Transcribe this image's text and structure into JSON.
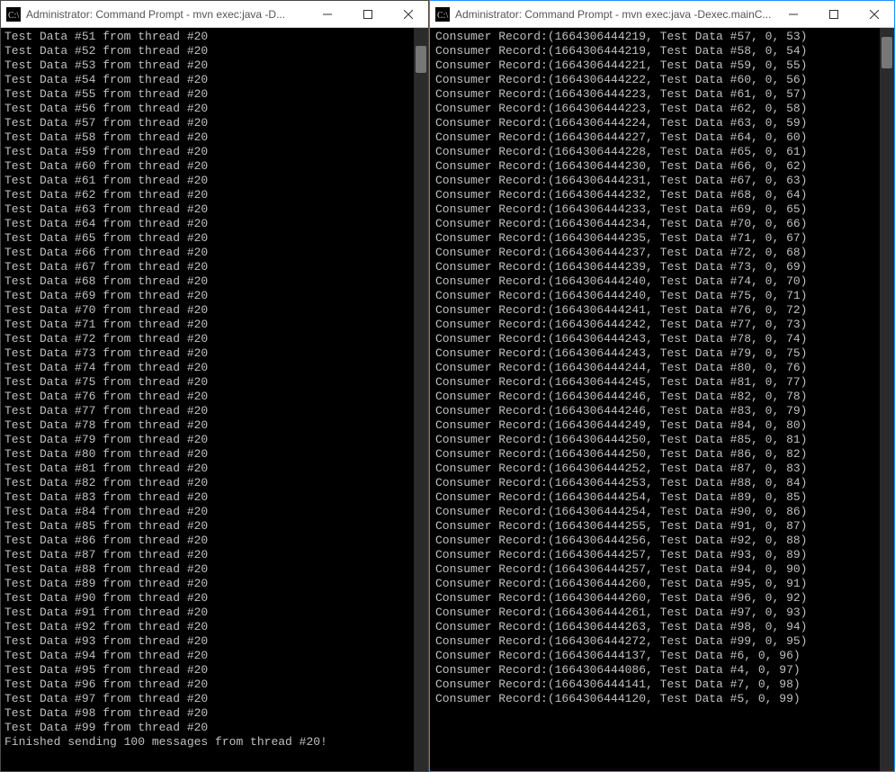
{
  "left_window": {
    "title": "Administrator: Command Prompt - mvn  exec:java -D...",
    "lines": [
      "Test Data #51 from thread #20",
      "Test Data #52 from thread #20",
      "Test Data #53 from thread #20",
      "Test Data #54 from thread #20",
      "Test Data #55 from thread #20",
      "Test Data #56 from thread #20",
      "Test Data #57 from thread #20",
      "Test Data #58 from thread #20",
      "Test Data #59 from thread #20",
      "Test Data #60 from thread #20",
      "Test Data #61 from thread #20",
      "Test Data #62 from thread #20",
      "Test Data #63 from thread #20",
      "Test Data #64 from thread #20",
      "Test Data #65 from thread #20",
      "Test Data #66 from thread #20",
      "Test Data #67 from thread #20",
      "Test Data #68 from thread #20",
      "Test Data #69 from thread #20",
      "Test Data #70 from thread #20",
      "Test Data #71 from thread #20",
      "Test Data #72 from thread #20",
      "Test Data #73 from thread #20",
      "Test Data #74 from thread #20",
      "Test Data #75 from thread #20",
      "Test Data #76 from thread #20",
      "Test Data #77 from thread #20",
      "Test Data #78 from thread #20",
      "Test Data #79 from thread #20",
      "Test Data #80 from thread #20",
      "Test Data #81 from thread #20",
      "Test Data #82 from thread #20",
      "Test Data #83 from thread #20",
      "Test Data #84 from thread #20",
      "Test Data #85 from thread #20",
      "Test Data #86 from thread #20",
      "Test Data #87 from thread #20",
      "Test Data #88 from thread #20",
      "Test Data #89 from thread #20",
      "Test Data #90 from thread #20",
      "Test Data #91 from thread #20",
      "Test Data #92 from thread #20",
      "Test Data #93 from thread #20",
      "Test Data #94 from thread #20",
      "Test Data #95 from thread #20",
      "Test Data #96 from thread #20",
      "Test Data #97 from thread #20",
      "Test Data #98 from thread #20",
      "Test Data #99 from thread #20",
      "Finished sending 100 messages from thread #20!"
    ]
  },
  "right_window": {
    "title": "Administrator: Command Prompt - mvn  exec:java -Dexec.mainC...",
    "lines": [
      "Consumer Record:(1664306444219, Test Data #57, 0, 53)",
      "Consumer Record:(1664306444219, Test Data #58, 0, 54)",
      "Consumer Record:(1664306444221, Test Data #59, 0, 55)",
      "Consumer Record:(1664306444222, Test Data #60, 0, 56)",
      "Consumer Record:(1664306444223, Test Data #61, 0, 57)",
      "Consumer Record:(1664306444223, Test Data #62, 0, 58)",
      "Consumer Record:(1664306444224, Test Data #63, 0, 59)",
      "Consumer Record:(1664306444227, Test Data #64, 0, 60)",
      "Consumer Record:(1664306444228, Test Data #65, 0, 61)",
      "Consumer Record:(1664306444230, Test Data #66, 0, 62)",
      "Consumer Record:(1664306444231, Test Data #67, 0, 63)",
      "Consumer Record:(1664306444232, Test Data #68, 0, 64)",
      "Consumer Record:(1664306444233, Test Data #69, 0, 65)",
      "Consumer Record:(1664306444234, Test Data #70, 0, 66)",
      "Consumer Record:(1664306444235, Test Data #71, 0, 67)",
      "Consumer Record:(1664306444237, Test Data #72, 0, 68)",
      "Consumer Record:(1664306444239, Test Data #73, 0, 69)",
      "Consumer Record:(1664306444240, Test Data #74, 0, 70)",
      "Consumer Record:(1664306444240, Test Data #75, 0, 71)",
      "Consumer Record:(1664306444241, Test Data #76, 0, 72)",
      "Consumer Record:(1664306444242, Test Data #77, 0, 73)",
      "Consumer Record:(1664306444243, Test Data #78, 0, 74)",
      "Consumer Record:(1664306444243, Test Data #79, 0, 75)",
      "Consumer Record:(1664306444244, Test Data #80, 0, 76)",
      "Consumer Record:(1664306444245, Test Data #81, 0, 77)",
      "Consumer Record:(1664306444246, Test Data #82, 0, 78)",
      "Consumer Record:(1664306444246, Test Data #83, 0, 79)",
      "Consumer Record:(1664306444249, Test Data #84, 0, 80)",
      "Consumer Record:(1664306444250, Test Data #85, 0, 81)",
      "Consumer Record:(1664306444250, Test Data #86, 0, 82)",
      "Consumer Record:(1664306444252, Test Data #87, 0, 83)",
      "Consumer Record:(1664306444253, Test Data #88, 0, 84)",
      "Consumer Record:(1664306444254, Test Data #89, 0, 85)",
      "Consumer Record:(1664306444254, Test Data #90, 0, 86)",
      "Consumer Record:(1664306444255, Test Data #91, 0, 87)",
      "Consumer Record:(1664306444256, Test Data #92, 0, 88)",
      "Consumer Record:(1664306444257, Test Data #93, 0, 89)",
      "Consumer Record:(1664306444257, Test Data #94, 0, 90)",
      "Consumer Record:(1664306444260, Test Data #95, 0, 91)",
      "Consumer Record:(1664306444260, Test Data #96, 0, 92)",
      "Consumer Record:(1664306444261, Test Data #97, 0, 93)",
      "Consumer Record:(1664306444263, Test Data #98, 0, 94)",
      "Consumer Record:(1664306444272, Test Data #99, 0, 95)",
      "Consumer Record:(1664306444137, Test Data #6, 0, 96)",
      "Consumer Record:(1664306444086, Test Data #4, 0, 97)",
      "Consumer Record:(1664306444141, Test Data #7, 0, 98)",
      "Consumer Record:(1664306444120, Test Data #5, 0, 99)"
    ]
  }
}
